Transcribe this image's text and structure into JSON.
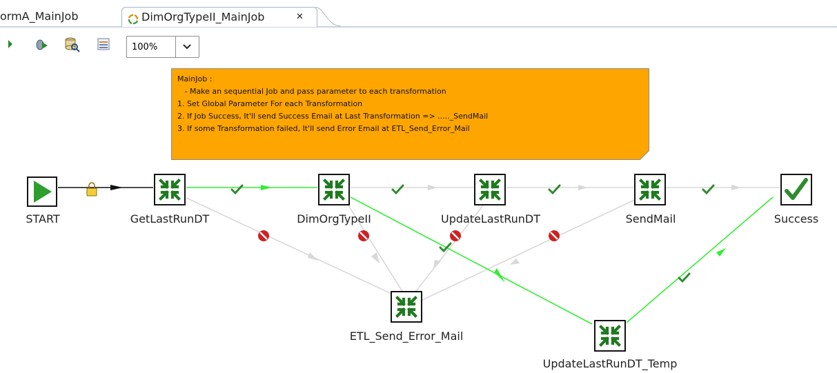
{
  "tabs": [
    {
      "label": "ormA_MainJob",
      "active": false
    },
    {
      "label": "DimOrgTypeII_MainJob",
      "active": true,
      "close_icon": "close-icon"
    }
  ],
  "toolbar": {
    "zoom_value": "100%",
    "buttons": [
      "run-icon",
      "debug-icon",
      "inspect-database-icon",
      "layout-icon"
    ]
  },
  "note": {
    "lines": [
      "MainJob :",
      "   - Make an sequential Job and pass parameter to each transformation",
      "1. Set Global Parameter For each Transformation",
      "2. If Job Success, It'll send Success Email at Last Transformation => ....._SendMail",
      "3. If some Transformation failed, It'll send Error Email at ETL_Send_Error_Mail"
    ],
    "color": "#ffa500"
  },
  "nodes": {
    "start": {
      "label": "START",
      "type": "start"
    },
    "getlastrundt": {
      "label": "GetLastRunDT",
      "type": "transformation"
    },
    "dimorgtypeii": {
      "label": "DimOrgTypeII",
      "type": "transformation"
    },
    "updatelastrundt": {
      "label": "UpdateLastRunDT",
      "type": "transformation"
    },
    "sendmail": {
      "label": "SendMail",
      "type": "transformation"
    },
    "success": {
      "label": "Success",
      "type": "success"
    },
    "etl_send_error_mail": {
      "label": "ETL_Send_Error_Mail",
      "type": "transformation"
    },
    "updatelastrundt_temp": {
      "label": "UpdateLastRunDT_Temp",
      "type": "transformation"
    }
  },
  "colors": {
    "hop_active": "#33ee33",
    "hop_inactive": "#d8d8d8",
    "success_check": "#2e8b2e",
    "error_badge": "#cc2222",
    "node_green": "#1f7a1f"
  }
}
